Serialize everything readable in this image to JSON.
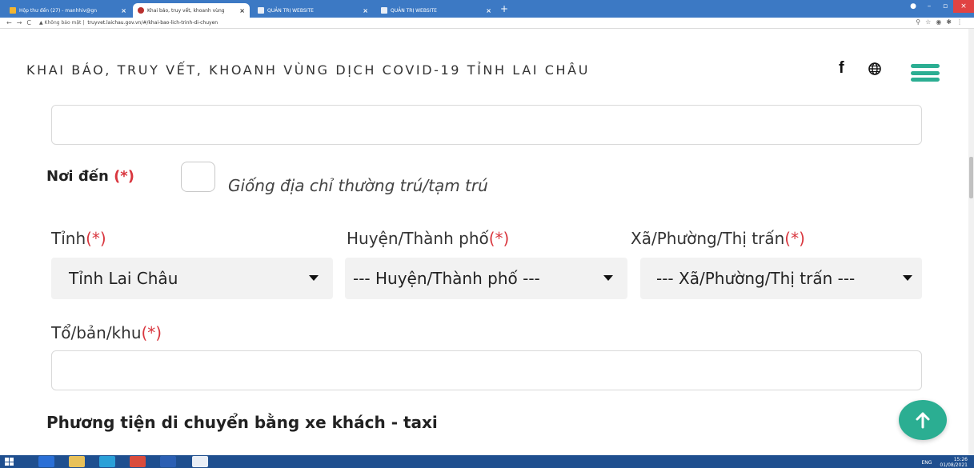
{
  "browser": {
    "tabs": [
      {
        "label": "Hộp thư đến (27) - manhhiv@gn",
        "active": false
      },
      {
        "label": "Khai báo, truy vết, khoanh vùng",
        "active": true
      },
      {
        "label": "QUẢN TRỊ WEBSITE",
        "active": false
      },
      {
        "label": "QUẢN TRỊ WEBSITE",
        "active": false
      }
    ],
    "security_warning": "Không bảo mật",
    "url": "truyvet.laichau.gov.vn/#/khai-bao-lich-trinh-di-chuyen"
  },
  "header": {
    "title": "KHAI BÁO, TRUY VẾT, KHOANH VÙNG DỊCH COVID-19 TỈNH LAI CHÂU",
    "facebook_glyph": "f",
    "accent_color": "#2bae92"
  },
  "form": {
    "destination_label": "Nơi đến",
    "required_mark": "(*)",
    "same_address_label": "Giống địa chỉ thường trú/tạm trú",
    "province_label": "Tỉnh",
    "district_label": "Huyện/Thành phố",
    "ward_label": "Xã/Phường/Thị trấn",
    "province_value": "Tỉnh Lai Châu",
    "district_value": "--- Huyện/Thành phố ---",
    "ward_value": "--- Xã/Phường/Thị trấn ---",
    "hamlet_label": "Tổ/bản/khu",
    "transport_heading": "Phương tiện di chuyển bằng xe khách - taxi"
  },
  "taskbar": {
    "lang": "ENG",
    "time": "15:26",
    "date": "01/08/2021"
  }
}
